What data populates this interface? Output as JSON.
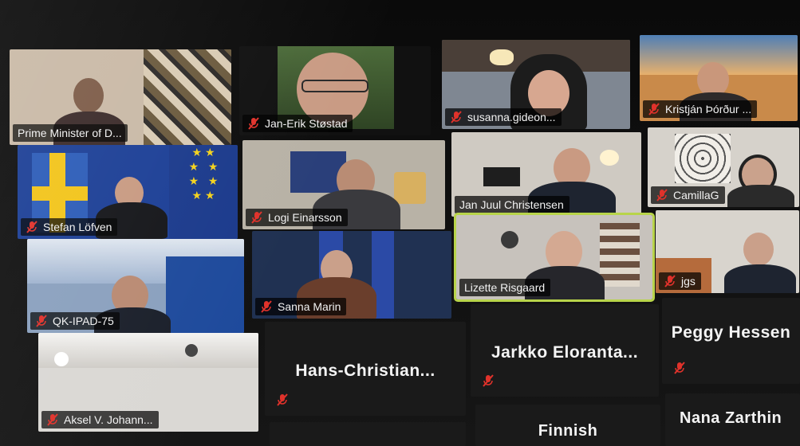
{
  "participants": [
    {
      "name": "Prime Minister of D...",
      "muted": false
    },
    {
      "name": "Jan-Erik Støstad",
      "muted": true
    },
    {
      "name": "susanna.gideon...",
      "muted": true
    },
    {
      "name": "Kristján Þórður ...",
      "muted": true
    },
    {
      "name": "Stefan Löfven",
      "muted": true
    },
    {
      "name": "Logi Einarsson",
      "muted": true
    },
    {
      "name": "Jan Juul Christensen",
      "muted": false
    },
    {
      "name": "CamillaG",
      "muted": true
    },
    {
      "name": "QK-IPAD-75",
      "muted": true
    },
    {
      "name": "Sanna Marin",
      "muted": true
    },
    {
      "name": "Lizette Risgaard",
      "muted": false,
      "active_speaker": true
    },
    {
      "name": "jgs",
      "muted": true
    },
    {
      "name": "Aksel V. Johann...",
      "muted": true
    },
    {
      "name": "Hans-Christian...",
      "muted": true,
      "video": false
    },
    {
      "name": "Jarkko Eloranta...",
      "muted": true,
      "video": false
    },
    {
      "name": "Peggy Hessen",
      "muted": true,
      "video": false
    },
    {
      "name": "Finnish",
      "video": false
    },
    {
      "name": "Nana Zarthin",
      "video": false
    }
  ],
  "colors": {
    "active_speaker_border": "#b8d44a",
    "mute_icon": "#e0322b",
    "nameplate_bg": "#000000"
  }
}
